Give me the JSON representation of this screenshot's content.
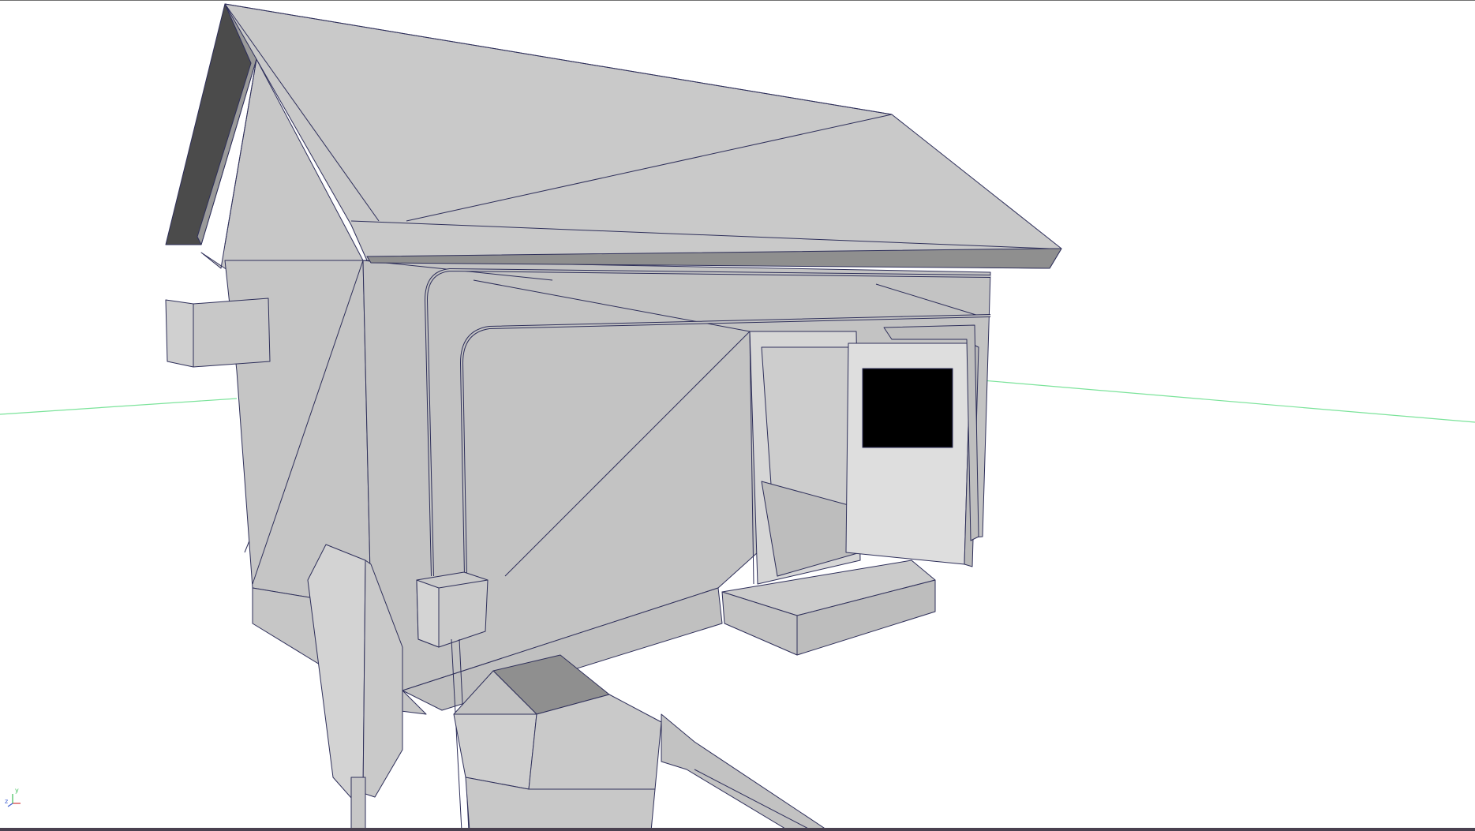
{
  "viewport": {
    "background": "#ffffff",
    "grid_axis_color": "#7be39a",
    "wire_color": "#2e2f5a",
    "shade_light": "#c9c9c9",
    "shade_mid": "#bdbdbd",
    "shade_dark": "#4b4b4b",
    "opening_color": "#000000"
  },
  "axis_gizmo": {
    "x_label": "x",
    "y_label": "y",
    "z_label": "z",
    "x_color": "#d13b3b",
    "y_color": "#3fbf5a",
    "z_color": "#3b5bd1"
  }
}
